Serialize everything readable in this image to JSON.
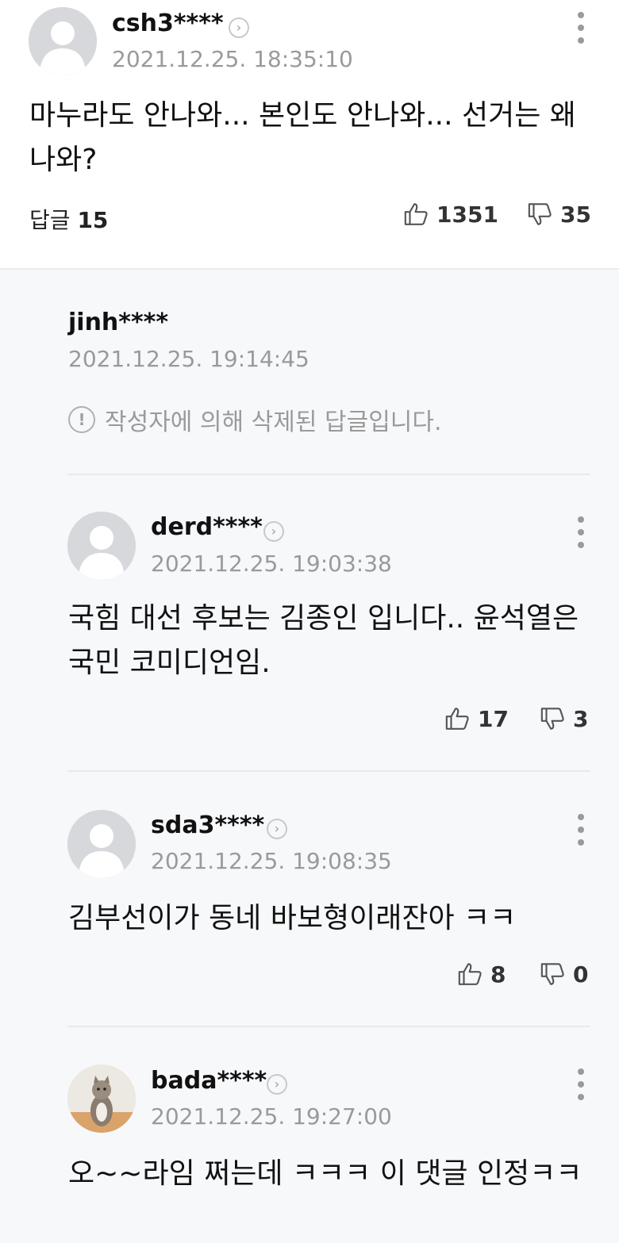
{
  "main_comment": {
    "username": "csh3****",
    "datetime": "2021.12.25. 18:35:10",
    "text": "마누라도 안나와... 본인도 안나와... 선거는 왜나와?",
    "reply_label": "답글",
    "reply_count": "15",
    "likes": "1351",
    "dislikes": "35"
  },
  "replies": [
    {
      "username": "jinh****",
      "datetime": "2021.12.25. 19:14:45",
      "deleted_notice": "작성자에 의해 삭제된 답글입니다."
    },
    {
      "username": "derd****",
      "datetime": "2021.12.25. 19:03:38",
      "text": "국힘 대선 후보는 김종인 입니다.. 윤석열은 국민 코미디언임.",
      "likes": "17",
      "dislikes": "3"
    },
    {
      "username": "sda3****",
      "datetime": "2021.12.25. 19:08:35",
      "text": "김부선이가 동네 바보형이래잔아 ㅋㅋ",
      "likes": "8",
      "dislikes": "0"
    },
    {
      "username": "bada****",
      "datetime": "2021.12.25. 19:27:00",
      "text": "오~~라임 쩌는데 ㅋㅋㅋ 이 댓글 인정ㅋㅋ"
    }
  ],
  "icons": {
    "profile_chevron": "chevron-right-icon",
    "more": "more-vertical-icon",
    "like": "thumbs-up-icon",
    "dislike": "thumbs-down-icon",
    "notice": "exclamation-circle-icon"
  }
}
